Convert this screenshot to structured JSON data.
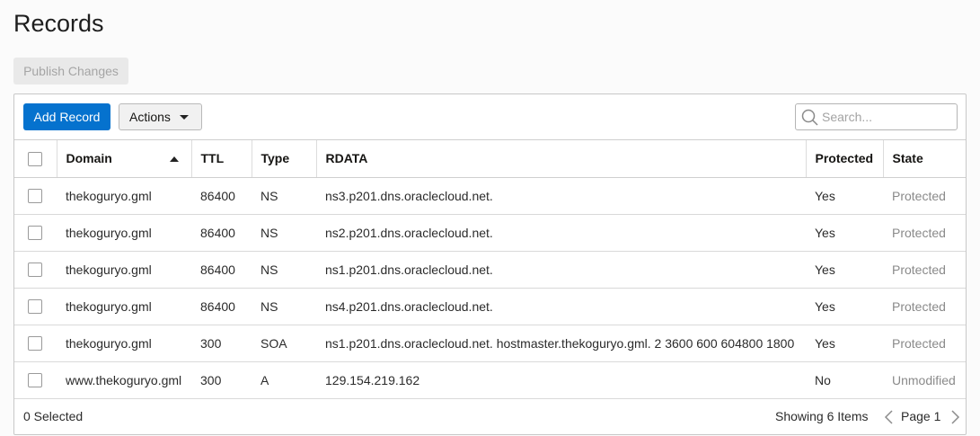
{
  "page": {
    "title": "Records"
  },
  "publish_button": {
    "label": "Publish Changes"
  },
  "toolbar": {
    "add_label": "Add Record",
    "actions_label": "Actions",
    "search_placeholder": "Search..."
  },
  "table": {
    "headers": [
      "Domain",
      "TTL",
      "Type",
      "RDATA",
      "Protected",
      "State"
    ],
    "sorted_column": "Domain",
    "sort_direction": "ascending",
    "rows": [
      {
        "domain": "thekoguryo.gml",
        "ttl": "86400",
        "type": "NS",
        "rdata": "ns3.p201.dns.oraclecloud.net.",
        "protected": "Yes",
        "state": "Protected"
      },
      {
        "domain": "thekoguryo.gml",
        "ttl": "86400",
        "type": "NS",
        "rdata": "ns2.p201.dns.oraclecloud.net.",
        "protected": "Yes",
        "state": "Protected"
      },
      {
        "domain": "thekoguryo.gml",
        "ttl": "86400",
        "type": "NS",
        "rdata": "ns1.p201.dns.oraclecloud.net.",
        "protected": "Yes",
        "state": "Protected"
      },
      {
        "domain": "thekoguryo.gml",
        "ttl": "86400",
        "type": "NS",
        "rdata": "ns4.p201.dns.oraclecloud.net.",
        "protected": "Yes",
        "state": "Protected"
      },
      {
        "domain": "thekoguryo.gml",
        "ttl": "300",
        "type": "SOA",
        "rdata": "ns1.p201.dns.oraclecloud.net. hostmaster.thekoguryo.gml. 2 3600 600 604800 1800",
        "protected": "Yes",
        "state": "Protected"
      },
      {
        "domain": "www.thekoguryo.gml",
        "ttl": "300",
        "type": "A",
        "rdata": "129.154.219.162",
        "protected": "No",
        "state": "Unmodified"
      }
    ]
  },
  "footer": {
    "selected": "0 Selected",
    "showing": "Showing 6 Items",
    "page": "Page 1"
  },
  "colors": {
    "primary": "#0572ce",
    "disabled_bg": "#e9e9e9",
    "state_text": "#8a8a8a"
  },
  "icons": {
    "search": "search-icon",
    "sort": "sort-ascending-icon",
    "prev": "chevron-left-icon",
    "next": "chevron-right-icon",
    "dropdown": "caret-down-icon"
  }
}
